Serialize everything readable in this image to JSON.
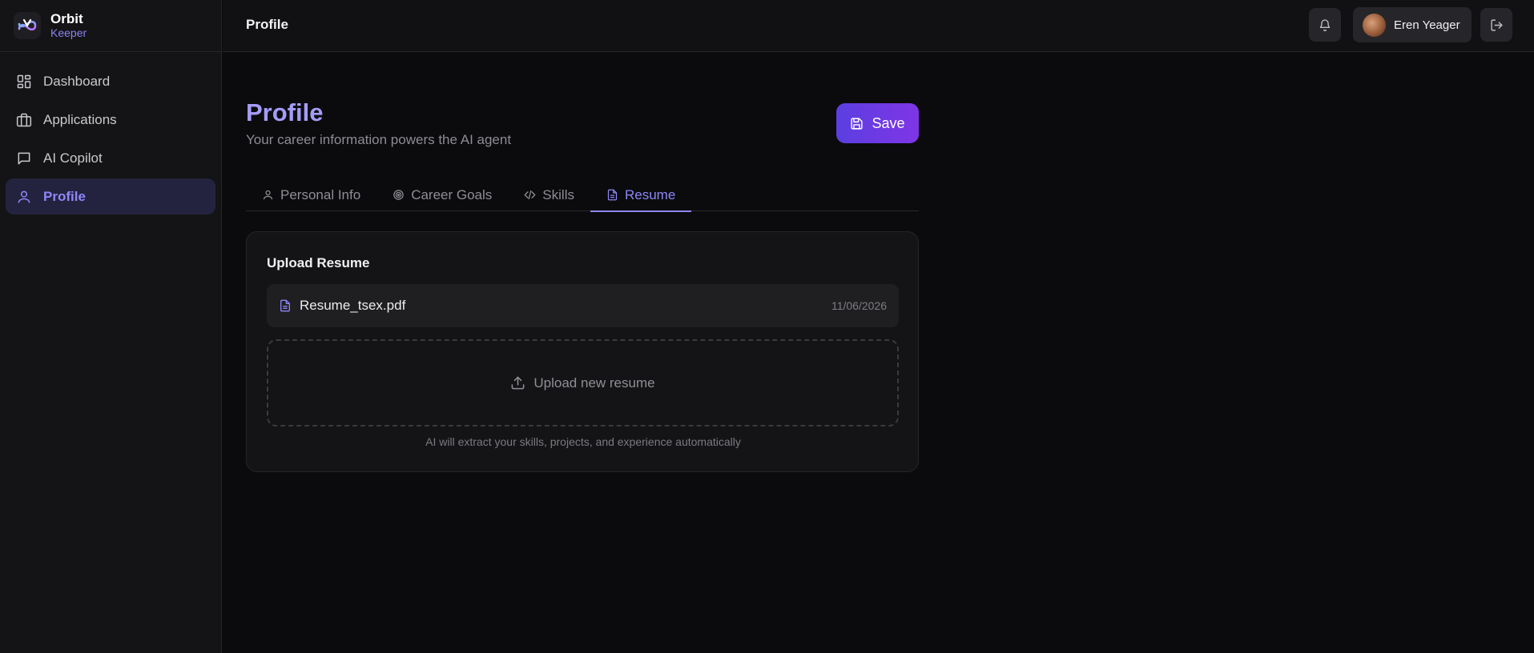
{
  "brand": {
    "name": "Orbit",
    "sub": "Keeper",
    "logo_icon": "orbit-logo-icon"
  },
  "sidebar": {
    "items": [
      {
        "label": "Dashboard",
        "icon": "dashboard-icon",
        "active": false
      },
      {
        "label": "Applications",
        "icon": "briefcase-icon",
        "active": false
      },
      {
        "label": "AI Copilot",
        "icon": "chat-icon",
        "active": false
      },
      {
        "label": "Profile",
        "icon": "user-icon",
        "active": true
      }
    ]
  },
  "topbar": {
    "title": "Profile",
    "notifications_icon": "bell-icon",
    "user_name": "Eren Yeager",
    "logout_icon": "logout-icon"
  },
  "page": {
    "title": "Profile",
    "subtitle": "Your career information powers the AI agent",
    "save_label": "Save"
  },
  "tabs": [
    {
      "label": "Personal Info",
      "icon": "user-icon",
      "active": false
    },
    {
      "label": "Career Goals",
      "icon": "target-icon",
      "active": false
    },
    {
      "label": "Skills",
      "icon": "code-icon",
      "active": false
    },
    {
      "label": "Resume",
      "icon": "file-icon",
      "active": true
    }
  ],
  "resume": {
    "card_title": "Upload Resume",
    "file_name": "Resume_tsex.pdf",
    "file_date": "11/06/2026",
    "upload_label": "Upload new resume",
    "hint": "AI will extract your skills, projects, and experience automatically"
  },
  "colors": {
    "accent": "#8e86f7",
    "save_gradient_start": "#5b3fe0",
    "save_gradient_end": "#7f35e6",
    "background": "#0b0b0d"
  }
}
